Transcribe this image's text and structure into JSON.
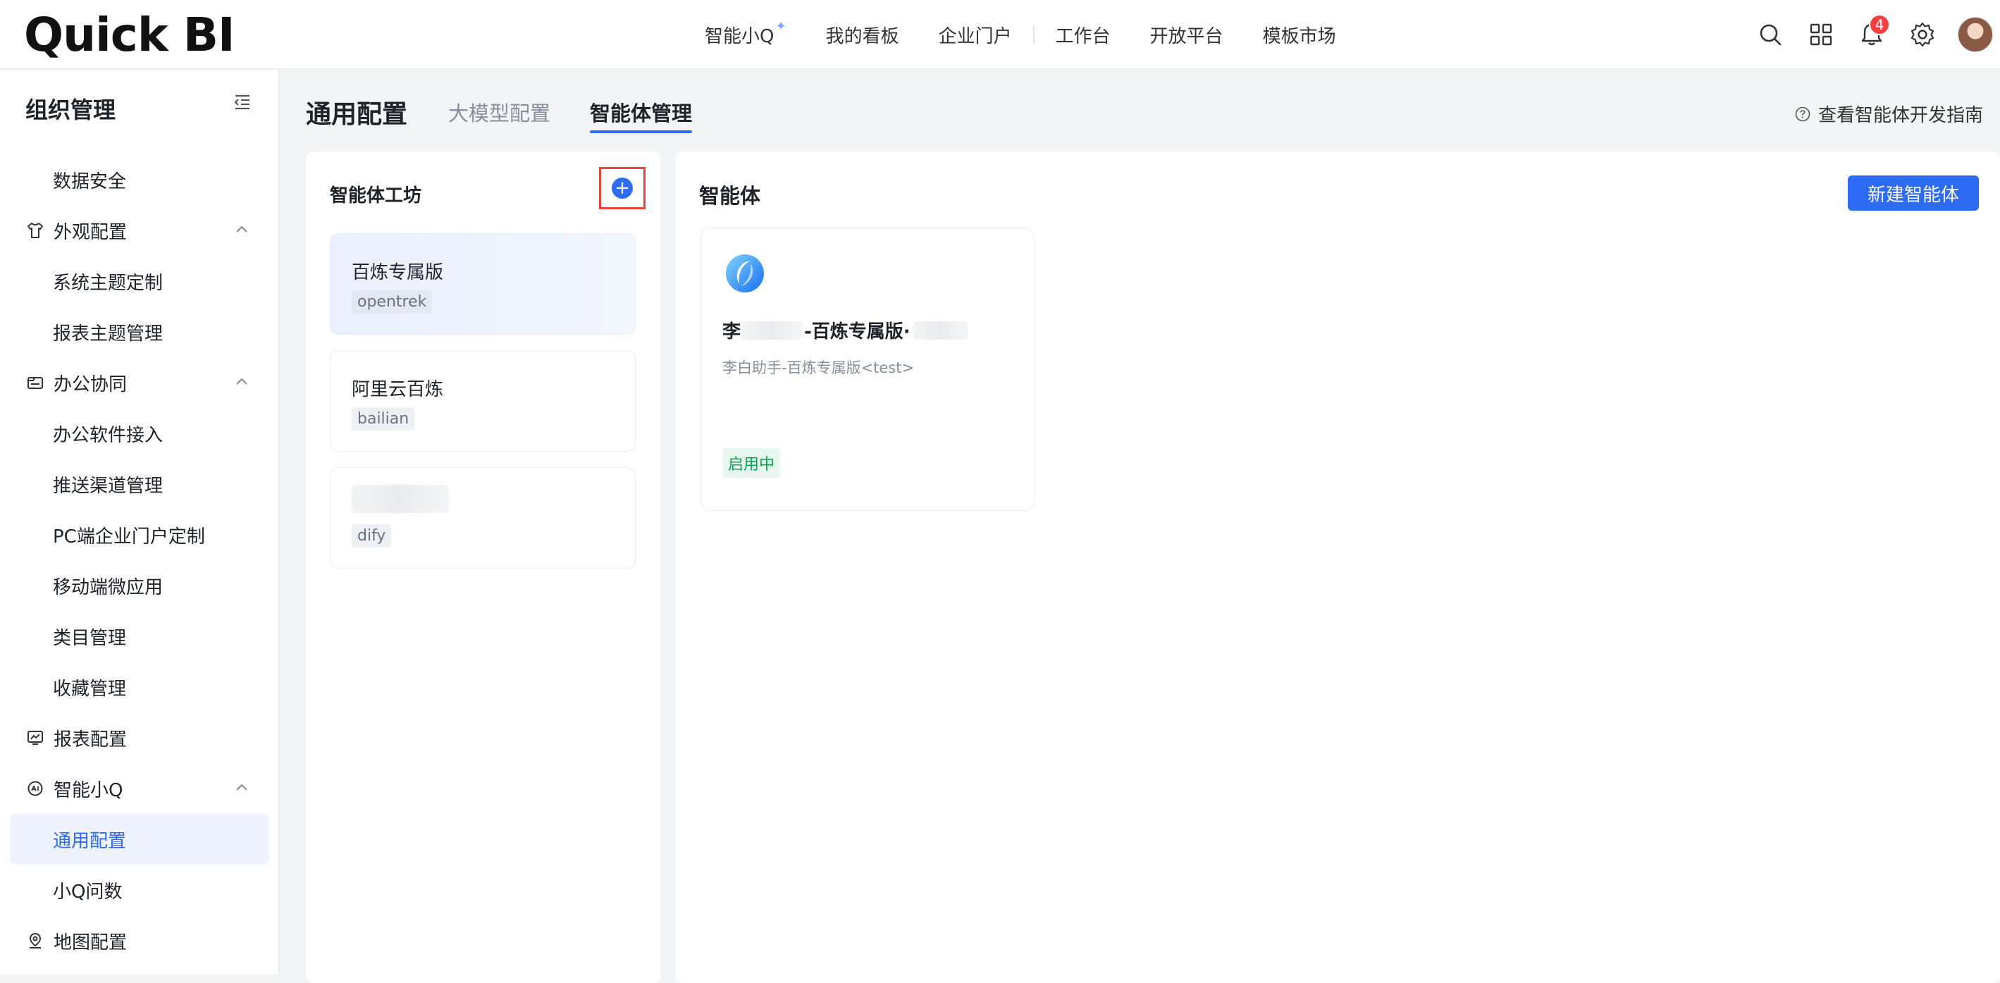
{
  "app": {
    "logo_text": "Quick BI"
  },
  "topnav": {
    "items": [
      "智能小Q",
      "我的看板",
      "企业门户",
      "工作台",
      "开放平台",
      "模板市场"
    ]
  },
  "topbar": {
    "notification_count": "4"
  },
  "sidebar": {
    "title": "组织管理",
    "items": [
      {
        "label": "数据安全",
        "type": "sub"
      },
      {
        "label": "外观配置",
        "type": "group",
        "icon": "shirt-icon"
      },
      {
        "label": "系统主题定制",
        "type": "sub"
      },
      {
        "label": "报表主题管理",
        "type": "sub"
      },
      {
        "label": "办公协同",
        "type": "group",
        "icon": "office-icon"
      },
      {
        "label": "办公软件接入",
        "type": "sub"
      },
      {
        "label": "推送渠道管理",
        "type": "sub"
      },
      {
        "label": "PC端企业门户定制",
        "type": "sub"
      },
      {
        "label": "移动端微应用",
        "type": "sub"
      },
      {
        "label": "类目管理",
        "type": "sub"
      },
      {
        "label": "收藏管理",
        "type": "sub"
      },
      {
        "label": "报表配置",
        "type": "group",
        "icon": "report-icon"
      },
      {
        "label": "智能小Q",
        "type": "group",
        "icon": "ai-icon"
      },
      {
        "label": "通用配置",
        "type": "sub",
        "active": true
      },
      {
        "label": "小Q问数",
        "type": "sub"
      },
      {
        "label": "地图配置",
        "type": "group",
        "icon": "map-icon"
      }
    ]
  },
  "page": {
    "title": "通用配置",
    "tabs": [
      "大模型配置",
      "智能体管理"
    ],
    "active_tab": "智能体管理",
    "guide_link": "查看智能体开发指南"
  },
  "workshop": {
    "title": "智能体工坊",
    "add_symbol": "+",
    "cards": [
      {
        "name": "百炼专属版",
        "tag": "opentrek",
        "selected": true
      },
      {
        "name": "阿里云百炼",
        "tag": "bailian",
        "selected": false
      },
      {
        "name": "",
        "tag": "dify",
        "selected": false
      }
    ]
  },
  "agents": {
    "title": "智能体",
    "new_button": "新建智能体",
    "items": [
      {
        "name_prefix": "李",
        "name_middle": "-百炼专属版·",
        "description": "李白助手-百炼专属版<test>",
        "status": "启用中"
      }
    ]
  },
  "colors": {
    "accent": "#2d6bf4",
    "highlight_border": "#e8453c",
    "status_green": "#00a854",
    "badge_red": "#f53f3f"
  }
}
